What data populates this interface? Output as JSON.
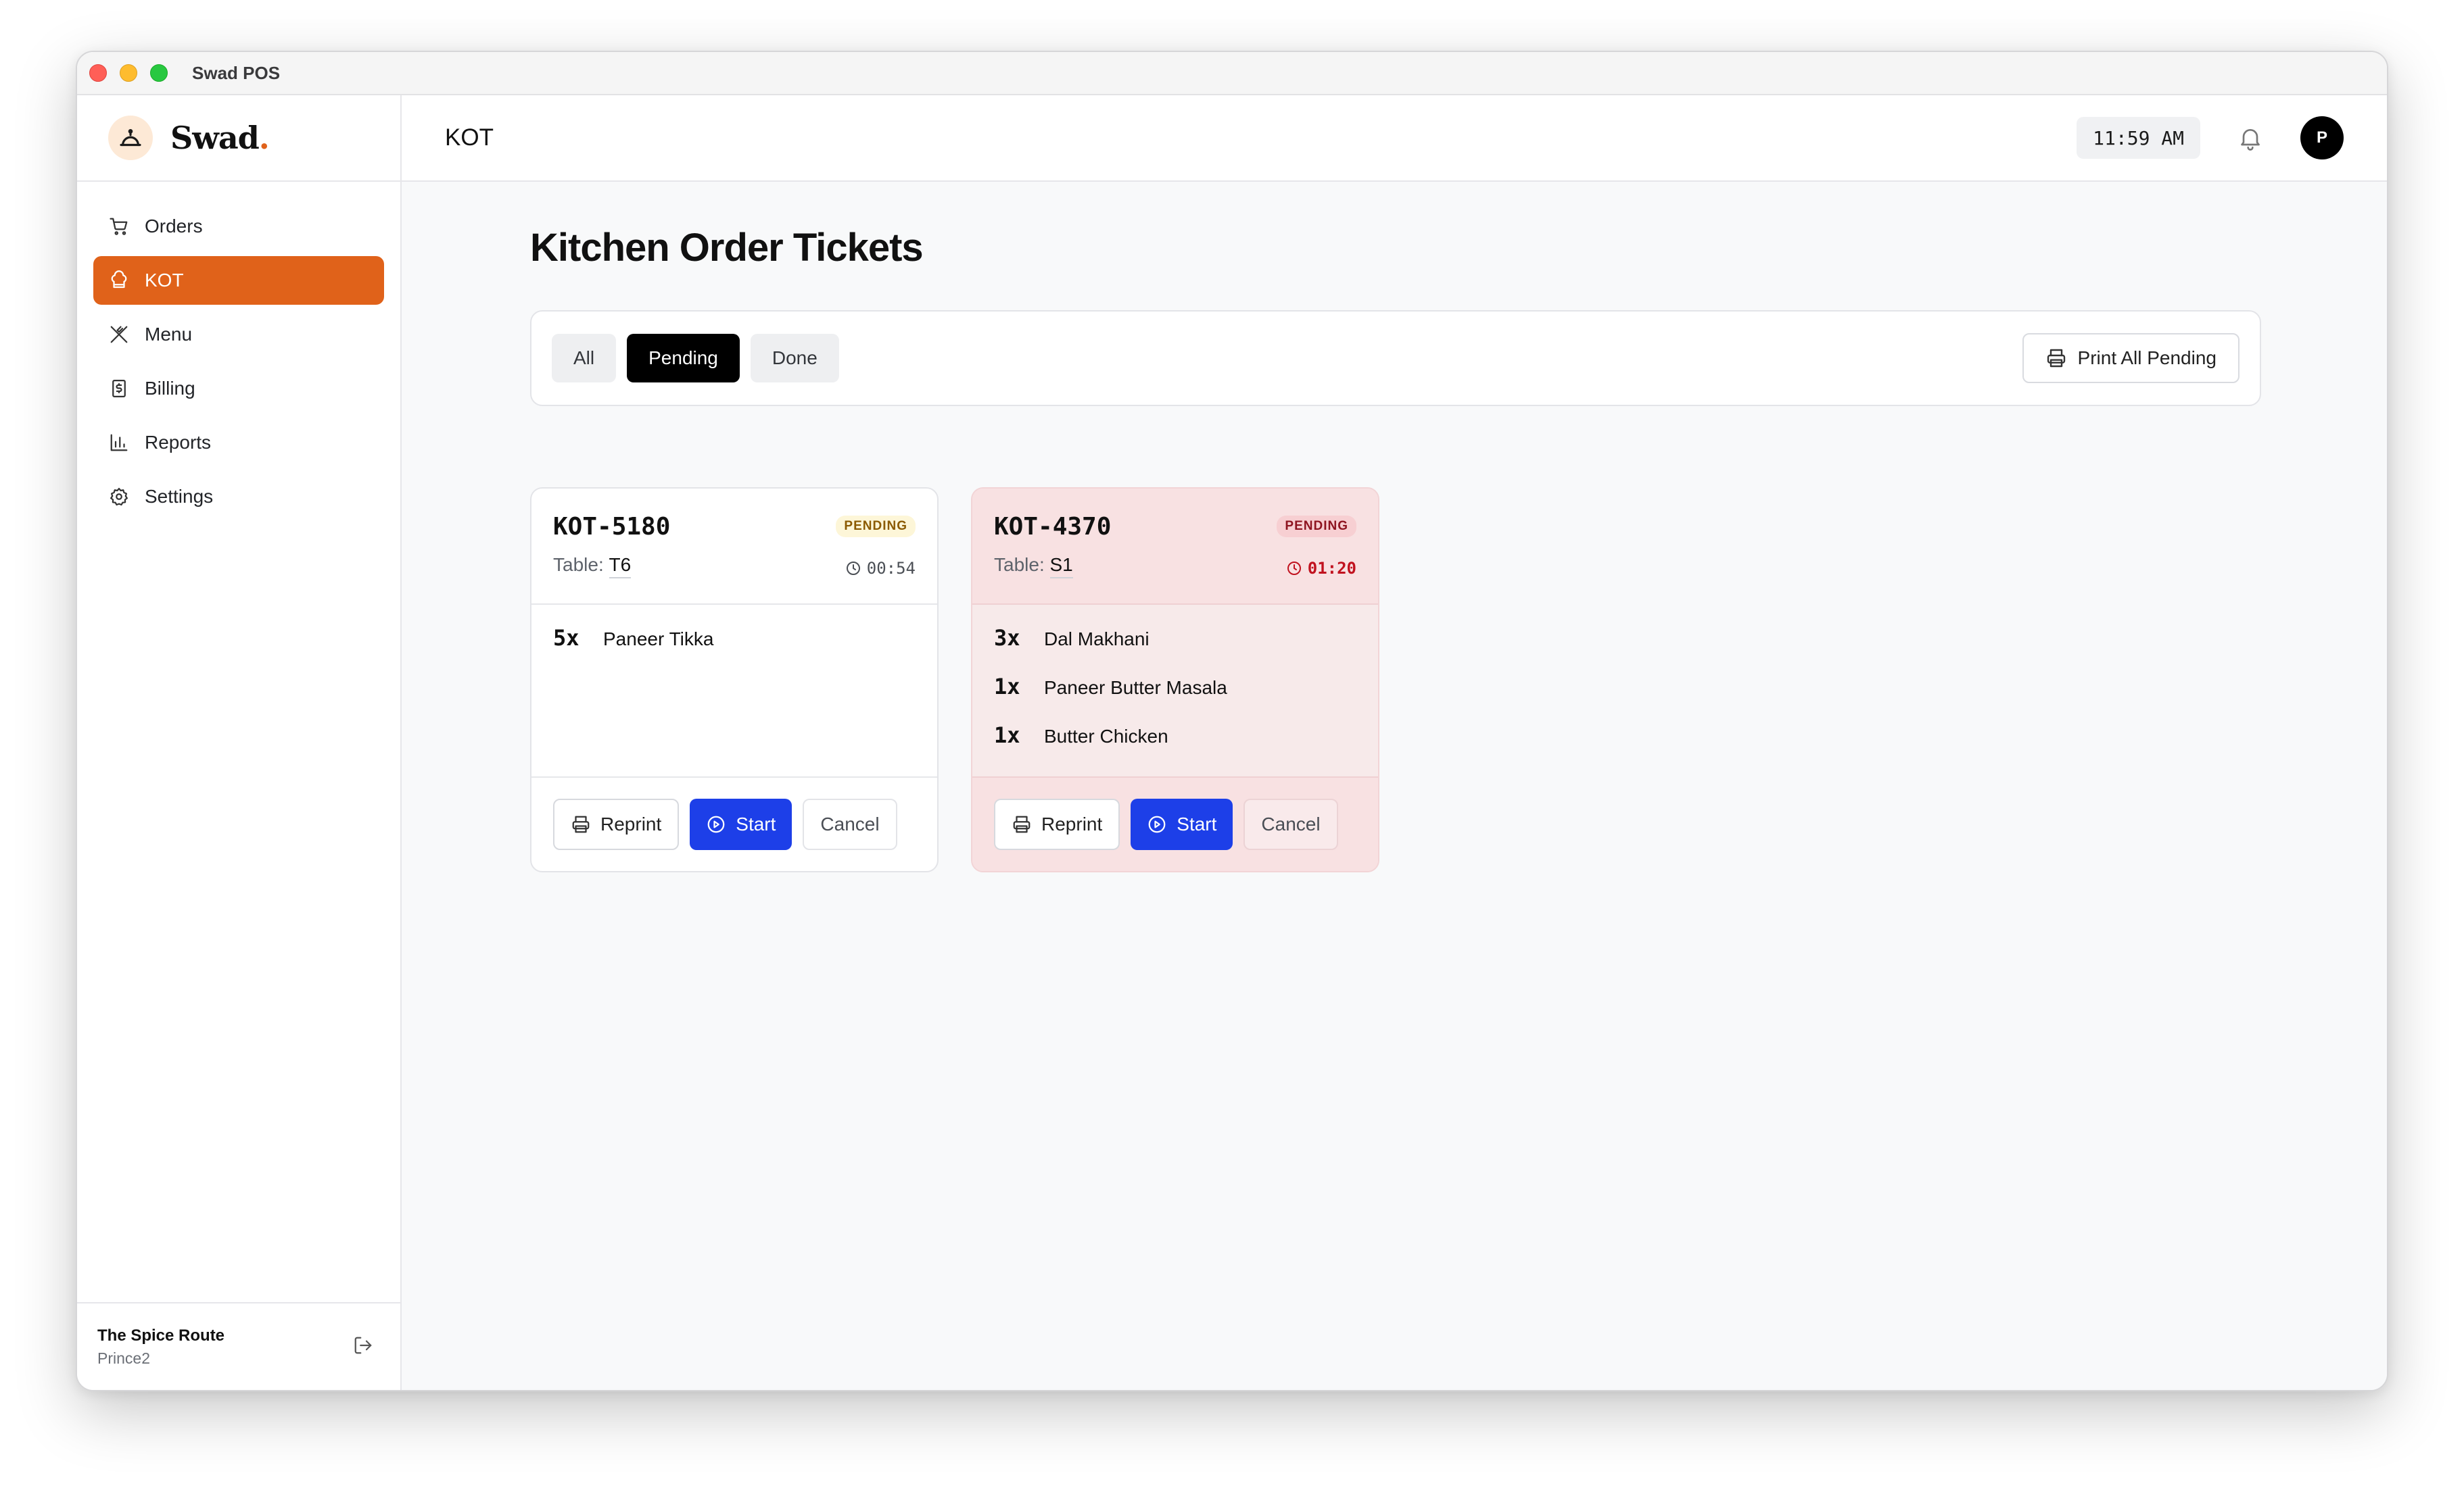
{
  "window": {
    "title": "Swad POS"
  },
  "brand": {
    "name": "Swad",
    "accent": "."
  },
  "sidebar": {
    "items": [
      {
        "label": "Orders",
        "icon": "cart-icon",
        "active": false
      },
      {
        "label": "KOT",
        "icon": "chef-hat-icon",
        "active": true
      },
      {
        "label": "Menu",
        "icon": "utensils-icon",
        "active": false
      },
      {
        "label": "Billing",
        "icon": "receipt-icon",
        "active": false
      },
      {
        "label": "Reports",
        "icon": "bar-chart-icon",
        "active": false
      },
      {
        "label": "Settings",
        "icon": "gear-icon",
        "active": false
      }
    ],
    "footer": {
      "org": "The Spice Route",
      "user": "Prince2"
    }
  },
  "header": {
    "page": "KOT",
    "time": "11:59 AM",
    "avatar_initial": "P"
  },
  "main": {
    "title": "Kitchen Order Tickets",
    "filters": [
      {
        "label": "All",
        "active": false
      },
      {
        "label": "Pending",
        "active": true
      },
      {
        "label": "Done",
        "active": false
      }
    ],
    "print_all_label": "Print All Pending"
  },
  "tickets": [
    {
      "id": "KOT-5180",
      "status": "PENDING",
      "table_label": "Table:",
      "table": "T6",
      "timer": "00:54",
      "overdue": false,
      "items": [
        {
          "qty": "5x",
          "name": "Paneer Tikka"
        }
      ],
      "actions": {
        "reprint": "Reprint",
        "start": "Start",
        "cancel": "Cancel"
      }
    },
    {
      "id": "KOT-4370",
      "status": "PENDING",
      "table_label": "Table:",
      "table": "S1",
      "timer": "01:20",
      "overdue": true,
      "items": [
        {
          "qty": "3x",
          "name": "Dal Makhani"
        },
        {
          "qty": "1x",
          "name": "Paneer Butter Masala"
        },
        {
          "qty": "1x",
          "name": "Butter Chicken"
        }
      ],
      "actions": {
        "reprint": "Reprint",
        "start": "Start",
        "cancel": "Cancel"
      }
    }
  ],
  "colors": {
    "accent": "#e0621a",
    "primary_button": "#1d3fe8",
    "overdue_bg": "#f7eaea",
    "overdue_text": "#c1121f"
  }
}
